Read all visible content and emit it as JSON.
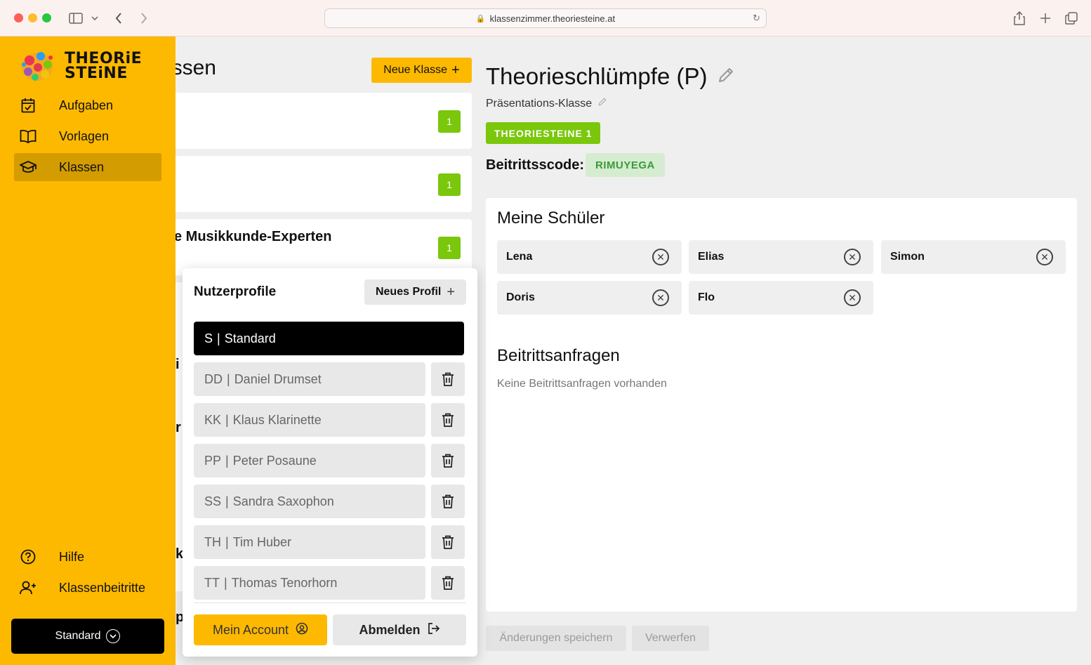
{
  "browser": {
    "url": "klassenzimmer.theoriesteine.at"
  },
  "logo": {
    "line1": "THEORiE",
    "line2": "STEiNE"
  },
  "sidebar": {
    "items": [
      {
        "label": "Aufgaben",
        "icon": "calendar-icon"
      },
      {
        "label": "Vorlagen",
        "icon": "book-icon"
      },
      {
        "label": "Klassen",
        "icon": "graduation-cap-icon",
        "active": true
      }
    ],
    "bottom_items": [
      {
        "label": "Hilfe",
        "icon": "help-circle-icon"
      },
      {
        "label": "Klassenbeitritte",
        "icon": "user-plus-icon"
      }
    ],
    "profile_button": "Standard"
  },
  "class_list": {
    "title": "Klassen",
    "new_button": "Neue Klasse",
    "cards": [
      {
        "name": "",
        "count": "1"
      },
      {
        "name": "",
        "count": "1"
      },
      {
        "name": "Die Musikkunde-Experten",
        "count": "1"
      }
    ],
    "peeks": [
      "i",
      "r",
      "k",
      "p"
    ]
  },
  "detail": {
    "title": "Theorieschlümpfe (P)",
    "subtitle": "Präsentations-Klasse",
    "tag": "THEORIESTEINE 1",
    "code_label": "Beitrittsscode:",
    "code": "RIMUYEGA",
    "students_heading": "Meine Schüler",
    "students": [
      "Lena",
      "Elias",
      "Simon",
      "Doris",
      "Flo"
    ],
    "requests_heading": "Beitrittsanfragen",
    "requests_empty": "Keine Beitrittsanfragen vorhanden",
    "save_button": "Änderungen speichern",
    "discard_button": "Verwerfen"
  },
  "profiles_popover": {
    "title": "Nutzerprofile",
    "new_button": "Neues Profil",
    "profiles": [
      {
        "initials": "S",
        "name": "Standard",
        "active": true
      },
      {
        "initials": "DD",
        "name": "Daniel Drumset"
      },
      {
        "initials": "KK",
        "name": "Klaus Klarinette"
      },
      {
        "initials": "PP",
        "name": "Peter Posaune"
      },
      {
        "initials": "SS",
        "name": "Sandra Saxophon"
      },
      {
        "initials": "TH",
        "name": "Tim Huber"
      },
      {
        "initials": "TT",
        "name": "Thomas Tenorhorn"
      }
    ],
    "account_button": "Mein Account",
    "logout_button": "Abmelden"
  },
  "colors": {
    "brand_yellow": "#fdb900",
    "active_nav": "#d39c00",
    "badge_green": "#7ac70c",
    "code_bg": "#d5ecd0",
    "code_text": "#3a9a3a"
  }
}
